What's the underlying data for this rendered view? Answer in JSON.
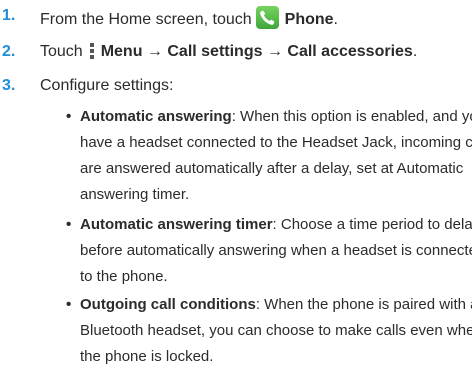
{
  "steps": [
    {
      "number": "1.",
      "prefix": "From the Home screen, touch",
      "app_name": "Phone",
      "suffix": ".",
      "icon": "phone-app-icon"
    },
    {
      "number": "2.",
      "prefix": "Touch",
      "menu_path": "Menu → Call settings → Call accessories",
      "suffix": ".",
      "icon": "menu-icon"
    },
    {
      "number": "3.",
      "text": "Configure settings:"
    }
  ],
  "bullets": [
    {
      "title": "Automatic answering",
      "lines": [
        ": When this option is enabled, and you",
        "have a headset connected to the Headset Jack, incoming calls",
        "are answered automatically after a delay, set at Automatic",
        "answering timer."
      ]
    },
    {
      "title": "Automatic answering timer",
      "lines": [
        ": Choose a time period to delay",
        "before automatically answering when a headset is connected",
        "to the phone."
      ]
    },
    {
      "title": "Outgoing call conditions",
      "lines": [
        ": When the phone is paired with a",
        "Bluetooth headset, you can choose to make calls even when",
        "the phone is locked."
      ]
    }
  ],
  "colors": {
    "step_number": "#1f8fd8",
    "text": "#2b2b2b",
    "icon_green": "#4bb544"
  }
}
